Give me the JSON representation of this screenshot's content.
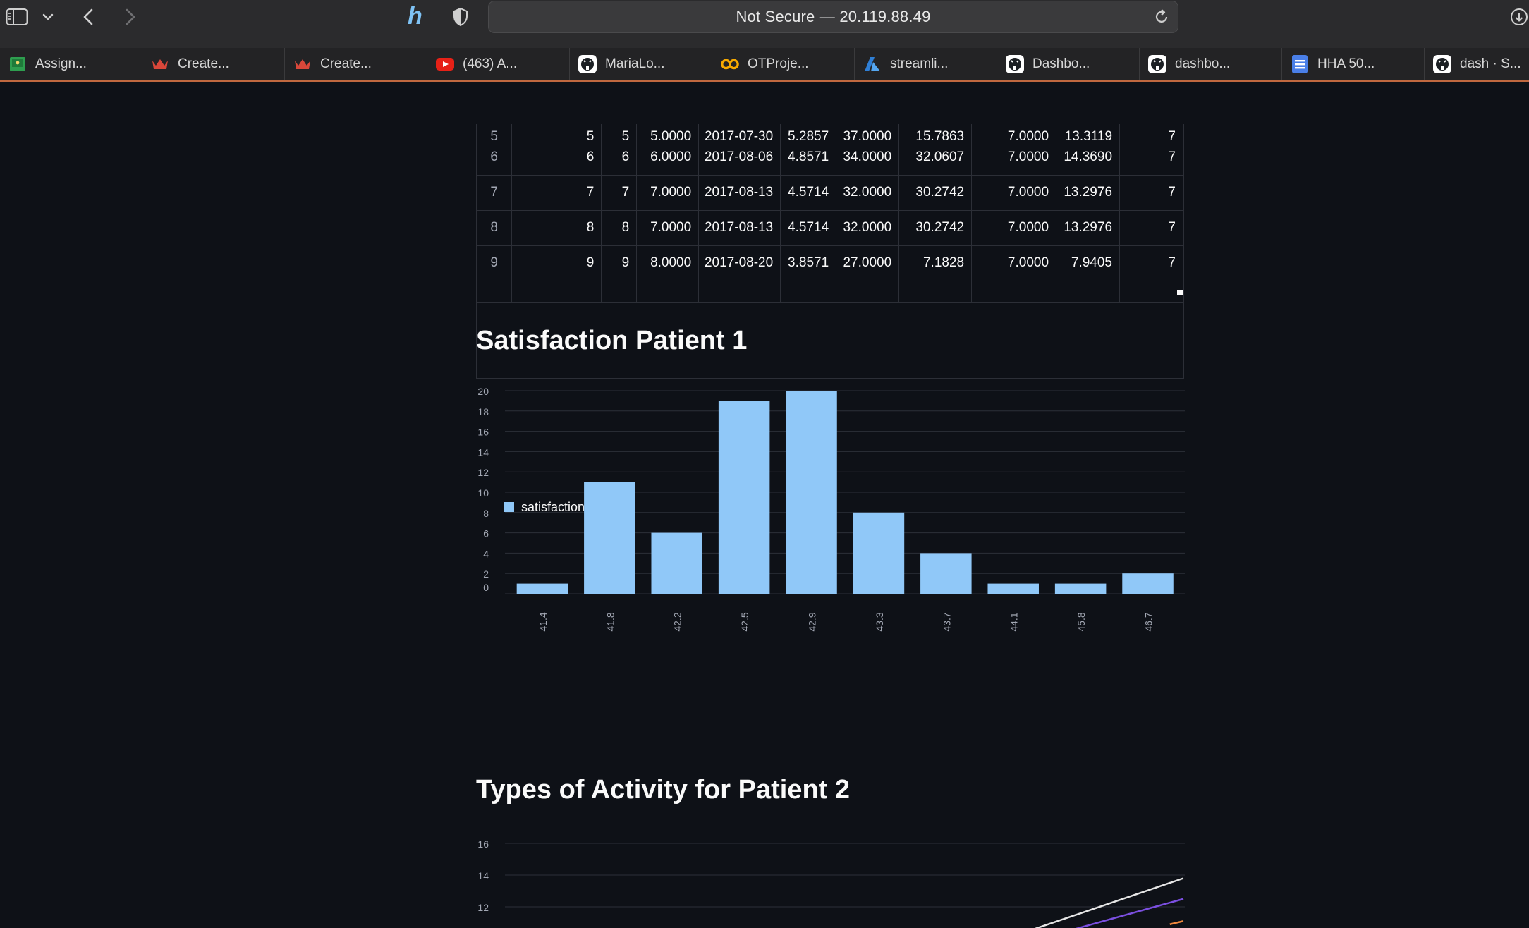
{
  "browser": {
    "address": "Not Secure — 20.119.88.49",
    "icons": [
      "sidebar-toggle-icon",
      "chevron-down-icon",
      "back-arrow-icon",
      "forward-arrow-icon",
      "honey-extension-icon",
      "privacy-shield-icon",
      "reload-icon",
      "downloads-icon"
    ],
    "tabs": [
      {
        "label": "Assign...",
        "icon": "google-classroom-icon",
        "color": "#2e9e4f"
      },
      {
        "label": "Create...",
        "icon": "crown-icon",
        "color": "#d9473a"
      },
      {
        "label": "Create...",
        "icon": "crown-icon",
        "color": "#d9473a"
      },
      {
        "label": "(463) A...",
        "icon": "youtube-icon",
        "color": "#e62117"
      },
      {
        "label": "MariaLo...",
        "icon": "github-icon",
        "color": "#ffffff"
      },
      {
        "label": "OTProje...",
        "icon": "colab-icon",
        "color": "#f9ab00"
      },
      {
        "label": "streamli...",
        "icon": "azure-icon",
        "color": "#2f7fd6"
      },
      {
        "label": "Dashbo...",
        "icon": "github-icon",
        "color": "#ffffff"
      },
      {
        "label": "dashbo...",
        "icon": "github-icon",
        "color": "#ffffff"
      },
      {
        "label": "HHA 50...",
        "icon": "google-docs-icon",
        "color": "#4a7fe8"
      },
      {
        "label": "dash · S...",
        "icon": "github-icon",
        "color": "#ffffff"
      }
    ]
  },
  "table": {
    "rows": [
      {
        "index": "6",
        "cells": [
          "6",
          "6",
          "6.0000",
          "2017-08-06",
          "4.8571",
          "34.0000",
          "32.0607",
          "7.0000",
          "14.3690",
          "7"
        ]
      },
      {
        "index": "7",
        "cells": [
          "7",
          "7",
          "7.0000",
          "2017-08-13",
          "4.5714",
          "32.0000",
          "30.2742",
          "7.0000",
          "13.2976",
          "7"
        ]
      },
      {
        "index": "8",
        "cells": [
          "8",
          "8",
          "7.0000",
          "2017-08-13",
          "4.5714",
          "32.0000",
          "30.2742",
          "7.0000",
          "13.2976",
          "7"
        ]
      },
      {
        "index": "9",
        "cells": [
          "9",
          "9",
          "8.0000",
          "2017-08-20",
          "3.8571",
          "27.0000",
          "7.1828",
          "7.0000",
          "7.9405",
          "7"
        ]
      }
    ]
  },
  "sections": {
    "satisfaction_title": "Satisfaction Patient 1",
    "activity_title": "Types of Activity for Patient 2"
  },
  "chart_data": [
    {
      "type": "bar",
      "title": "Satisfaction Patient 1",
      "categories": [
        "41.4",
        "41.8",
        "42.2",
        "42.5",
        "42.9",
        "43.3",
        "43.7",
        "44.1",
        "45.8",
        "46.7"
      ],
      "series": [
        {
          "name": "satisfaction",
          "values": [
            1,
            11,
            6,
            19,
            20,
            8,
            4,
            1,
            1,
            2
          ],
          "color": "#90c8f8"
        }
      ],
      "ylim": [
        0,
        20
      ],
      "yticks": [
        0,
        2,
        4,
        6,
        8,
        10,
        12,
        14,
        16,
        18,
        20
      ],
      "grid": true,
      "legend": "bottom-left",
      "xlabel": "",
      "ylabel": ""
    },
    {
      "type": "line",
      "title": "Types of Activity for Patient 2",
      "yticks": [
        12,
        14,
        16
      ],
      "grid": true,
      "series": [
        {
          "color": "#e6e6e6",
          "x": [
            0.78,
            1.0
          ],
          "y": [
            10.6,
            13.8
          ]
        },
        {
          "color": "#7b4fe0",
          "x": [
            0.84,
            1.0
          ],
          "y": [
            10.6,
            12.5
          ]
        },
        {
          "color": "#f0883e",
          "x": [
            0.98,
            1.0
          ],
          "y": [
            10.9,
            11.1
          ]
        }
      ]
    }
  ]
}
